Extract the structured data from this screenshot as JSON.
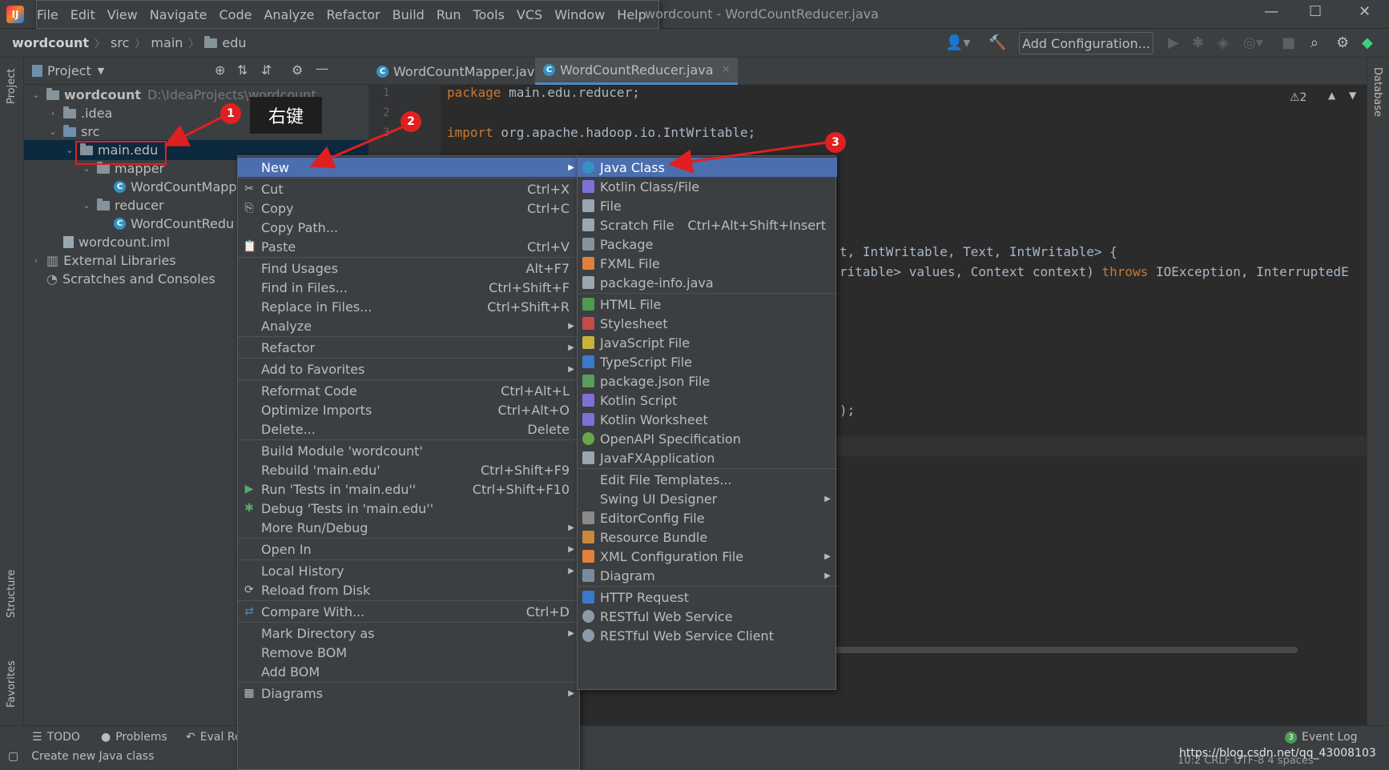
{
  "titlebar": {
    "app_icon": "intellij-icon",
    "menu": [
      "File",
      "Edit",
      "View",
      "Navigate",
      "Code",
      "Analyze",
      "Refactor",
      "Build",
      "Run",
      "Tools",
      "VCS",
      "Window",
      "Help"
    ],
    "window_title": "wordcount - WordCountReducer.java",
    "minimize": "—",
    "maximize": "☐",
    "close": "✕"
  },
  "navbar": {
    "crumbs": [
      "wordcount",
      "src",
      "main",
      "edu"
    ],
    "add_config": "Add Configuration..."
  },
  "project": {
    "header": "Project",
    "tree": [
      {
        "label": "wordcount",
        "dim": "D:\\IdeaProjects\\wordcount",
        "indent": 0,
        "arrow": "⌄",
        "icon": "folder"
      },
      {
        "label": ".idea",
        "indent": 1,
        "arrow": "›",
        "icon": "folder"
      },
      {
        "label": "src",
        "indent": 1,
        "arrow": "⌄",
        "icon": "folder-blue"
      },
      {
        "label": "main.edu",
        "indent": 2,
        "arrow": "⌄",
        "icon": "folder"
      },
      {
        "label": "mapper",
        "indent": 3,
        "arrow": "⌄",
        "icon": "folder"
      },
      {
        "label": "WordCountMapp",
        "indent": 4,
        "arrow": "",
        "icon": "class"
      },
      {
        "label": "reducer",
        "indent": 3,
        "arrow": "⌄",
        "icon": "folder"
      },
      {
        "label": "WordCountRedu",
        "indent": 4,
        "arrow": "",
        "icon": "class"
      },
      {
        "label": "wordcount.iml",
        "indent": 1,
        "arrow": "",
        "icon": "file"
      },
      {
        "label": "External Libraries",
        "indent": 0,
        "arrow": "›",
        "icon": "lib"
      },
      {
        "label": "Scratches and Consoles",
        "indent": 0,
        "arrow": "",
        "icon": "scratch"
      }
    ]
  },
  "tabs": [
    "WordCountMapper.java",
    "WordCountReducer.java"
  ],
  "editor": {
    "line_numbers": [
      "1",
      "2",
      "3"
    ],
    "line1_kw": "package",
    "line1_rest": " main.edu.reducer;",
    "line3_kw": "import",
    "line3_rest": " org.apache.hadoop.io.IntWritable;",
    "line_a": "t, IntWritable, Text, IntWritable> {",
    "line_b_pre": "ritable> values, Context context) ",
    "line_b_kw": "throws",
    "line_b_post": " IOException, InterruptedE",
    "line_c": ");",
    "warning": "⚠2"
  },
  "left_strip": [
    "Project",
    "Structure",
    "Favorites"
  ],
  "right_strip": [
    "Database"
  ],
  "context_menu": [
    {
      "label": "New",
      "hl": true,
      "sub": true
    },
    {
      "div": true
    },
    {
      "label": "Cut",
      "sc": "Ctrl+X",
      "icon": "✂"
    },
    {
      "label": "Copy",
      "sc": "Ctrl+C",
      "icon": "⎘"
    },
    {
      "label": "Copy Path..."
    },
    {
      "label": "Paste",
      "sc": "Ctrl+V",
      "icon": "📋"
    },
    {
      "div": true
    },
    {
      "label": "Find Usages",
      "sc": "Alt+F7"
    },
    {
      "label": "Find in Files...",
      "sc": "Ctrl+Shift+F"
    },
    {
      "label": "Replace in Files...",
      "sc": "Ctrl+Shift+R"
    },
    {
      "label": "Analyze",
      "sub": true
    },
    {
      "div": true
    },
    {
      "label": "Refactor",
      "sub": true
    },
    {
      "div": true
    },
    {
      "label": "Add to Favorites",
      "sub": true
    },
    {
      "div": true
    },
    {
      "label": "Reformat Code",
      "sc": "Ctrl+Alt+L"
    },
    {
      "label": "Optimize Imports",
      "sc": "Ctrl+Alt+O"
    },
    {
      "label": "Delete...",
      "sc": "Delete"
    },
    {
      "div": true
    },
    {
      "label": "Build Module 'wordcount'"
    },
    {
      "label": "Rebuild 'main.edu'",
      "sc": "Ctrl+Shift+F9"
    },
    {
      "label": "Run 'Tests in 'main.edu''",
      "sc": "Ctrl+Shift+F10",
      "icon": "▶"
    },
    {
      "label": "Debug 'Tests in 'main.edu''",
      "icon": "✱"
    },
    {
      "label": "More Run/Debug",
      "sub": true
    },
    {
      "div": true
    },
    {
      "label": "Open In",
      "sub": true
    },
    {
      "div": true
    },
    {
      "label": "Local History",
      "sub": true
    },
    {
      "label": "Reload from Disk",
      "icon": "⟳"
    },
    {
      "div": true
    },
    {
      "label": "Compare With...",
      "sc": "Ctrl+D",
      "icon": "⇄"
    },
    {
      "div": true
    },
    {
      "label": "Mark Directory as",
      "sub": true
    },
    {
      "label": "Remove BOM"
    },
    {
      "label": "Add BOM"
    },
    {
      "div": true
    },
    {
      "label": "Diagrams",
      "sub": true,
      "icon": "▦"
    }
  ],
  "submenu": [
    {
      "label": "Java Class",
      "hl": true,
      "icon": "class"
    },
    {
      "label": "Kotlin Class/File",
      "icon": "kotlin"
    },
    {
      "label": "File",
      "icon": "file"
    },
    {
      "label": "Scratch File",
      "sc": "Ctrl+Alt+Shift+Insert",
      "icon": "scratch"
    },
    {
      "label": "Package",
      "icon": "folder"
    },
    {
      "label": "FXML File",
      "icon": "xml"
    },
    {
      "label": "package-info.java",
      "icon": "file"
    },
    {
      "div": true
    },
    {
      "label": "HTML File",
      "icon": "html"
    },
    {
      "label": "Stylesheet",
      "icon": "css"
    },
    {
      "label": "JavaScript File",
      "icon": "js"
    },
    {
      "label": "TypeScript File",
      "icon": "ts"
    },
    {
      "label": "package.json File",
      "icon": "json"
    },
    {
      "label": "Kotlin Script",
      "icon": "kotlin"
    },
    {
      "label": "Kotlin Worksheet",
      "icon": "kotlin"
    },
    {
      "label": "OpenAPI Specification",
      "icon": "openapi"
    },
    {
      "label": "JavaFXApplication",
      "icon": "file"
    },
    {
      "div": true
    },
    {
      "label": "Edit File Templates..."
    },
    {
      "label": "Swing UI Designer",
      "sub": true
    },
    {
      "label": "EditorConfig File",
      "icon": "gear"
    },
    {
      "label": "Resource Bundle",
      "icon": "bundle"
    },
    {
      "label": "XML Configuration File",
      "sub": true,
      "icon": "xml"
    },
    {
      "label": "Diagram",
      "sub": true,
      "icon": "diagram"
    },
    {
      "div": true
    },
    {
      "label": "HTTP Request",
      "icon": "api"
    },
    {
      "label": "RESTful Web Service",
      "icon": "globe"
    },
    {
      "label": "RESTful Web Service Client",
      "icon": "globe"
    }
  ],
  "annotations": {
    "badge1": "1",
    "badge2": "2",
    "badge3": "3",
    "tooltip": "右键"
  },
  "bottom": {
    "tools": [
      "TODO",
      "Problems",
      "Eval Re"
    ],
    "event_log": "Event Log",
    "event_count": "3",
    "status": "Create new Java class",
    "right_status": "10:2  CRLF  UTF-8  4 spaces",
    "watermark": "https://blog.csdn.net/qq_43008103"
  },
  "colors": {
    "accent": "#4b6eaf",
    "annotation_red": "#e02020",
    "selection": "#0d293e"
  }
}
